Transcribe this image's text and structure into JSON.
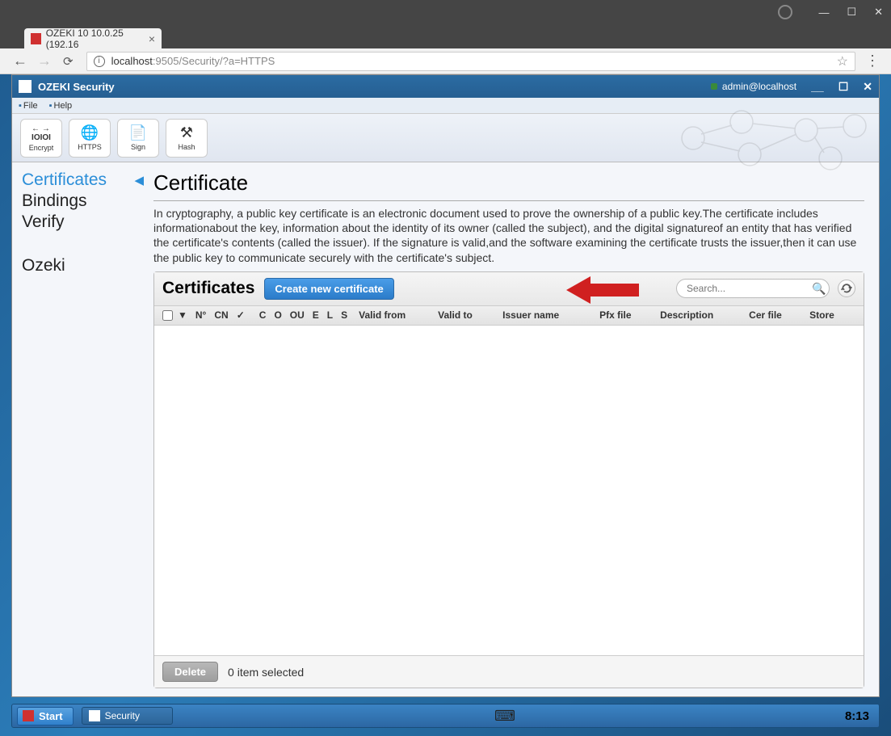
{
  "os_window": {
    "btn_min": "—",
    "btn_max": "☐",
    "btn_close": "✕"
  },
  "browser": {
    "tab_title": "OZEKI 10 10.0.25 (192.16",
    "url_host": "localhost",
    "url_port": ":9505",
    "url_path": "/Security/?a=HTTPS"
  },
  "app": {
    "title": "OZEKI Security",
    "user": "admin@localhost",
    "win_min": "__",
    "win_max": "☐",
    "win_close": "✕",
    "menu": {
      "file": "File",
      "help": "Help"
    },
    "toolbar": {
      "encrypt": "Encrypt",
      "https": "HTTPS",
      "sign": "Sign",
      "hash": "Hash"
    }
  },
  "sidebar": {
    "certificates": "Certificates",
    "bindings": "Bindings",
    "verify": "Verify",
    "ozeki": "Ozeki"
  },
  "content": {
    "heading": "Certificate",
    "description": "In cryptography, a public key certificate is an electronic document used to prove the ownership of a public key.The certificate includes informationabout the key, information about the identity of its owner (called the subject), and the digital signatureof an entity that has verified the certificate's contents (called the issuer). If the signature is valid,and the software examining the certificate trusts the issuer,then it can use the public key to communicate securely with the certificate's subject."
  },
  "grid": {
    "panel_title": "Certificates",
    "create_btn": "Create new certificate",
    "search_placeholder": "Search...",
    "columns": {
      "sort": "▼",
      "num": "N°",
      "cn": "CN",
      "c": "C",
      "o": "O",
      "ou": "OU",
      "e": "E",
      "l": "L",
      "s": "S",
      "valid_from": "Valid from",
      "valid_to": "Valid to",
      "issuer": "Issuer name",
      "pfx": "Pfx file",
      "desc": "Description",
      "cer": "Cer file",
      "store": "Store"
    },
    "delete_btn": "Delete",
    "selection": "0 item selected"
  },
  "taskbar": {
    "start": "Start",
    "security": "Security",
    "time": "8:13"
  }
}
